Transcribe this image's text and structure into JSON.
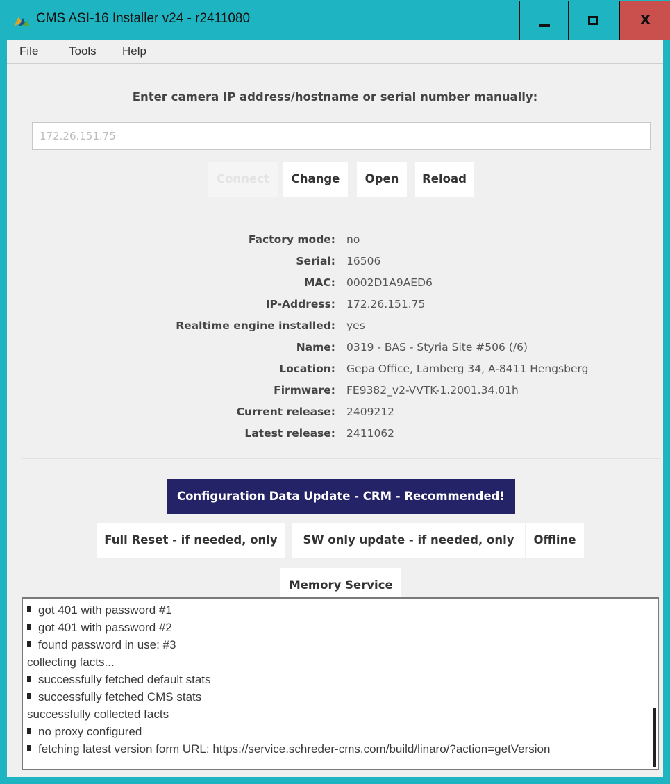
{
  "window": {
    "title": "CMS ASI-16 Installer v24 - r2411080",
    "close_glyph": "x",
    "colors": {
      "frame": "#1fb4c2",
      "close": "#c9504d",
      "primary_button": "#252367"
    }
  },
  "menubar": {
    "items": [
      "File",
      "Tools",
      "Help"
    ]
  },
  "connect": {
    "prompt": "Enter camera IP address/hostname or serial number manually:",
    "input_value": "172.26.151.75",
    "buttons": {
      "connect": "Connect",
      "change": "Change",
      "open": "Open",
      "reload": "Reload"
    }
  },
  "info": {
    "rows": [
      {
        "key": "Factory mode:",
        "value": "no"
      },
      {
        "key": "Serial:",
        "value": "16506"
      },
      {
        "key": "MAC:",
        "value": "0002D1A9AED6"
      },
      {
        "key": "IP-Address:",
        "value": "172.26.151.75"
      },
      {
        "key": "Realtime engine installed:",
        "value": "yes"
      },
      {
        "key": "Name:",
        "value": "0319 - BAS - Styria Site #506 (/6)"
      },
      {
        "key": "Location:",
        "value": "Gepa Office, Lamberg 34, A-8411 Hengsberg"
      },
      {
        "key": "Firmware:",
        "value": "FE9382_v2-VVTK-1.2001.34.01h"
      },
      {
        "key": "Current release:",
        "value": "2409212"
      },
      {
        "key": "Latest release:",
        "value": "2411062"
      }
    ]
  },
  "actions": {
    "config_update": "Configuration Data Update - CRM - Recommended!",
    "full_reset": "Full Reset - if needed, only",
    "sw_update": "SW only update - if needed, only",
    "offline": "Offline",
    "memory_service": "Memory Service"
  },
  "log": {
    "lines": [
      {
        "bullet": true,
        "text": "got 401 with password #1"
      },
      {
        "bullet": true,
        "text": "got 401 with password #2"
      },
      {
        "bullet": true,
        "text": "found password in use: #3"
      },
      {
        "bullet": false,
        "text": "collecting facts..."
      },
      {
        "bullet": true,
        "text": "successfully fetched default stats"
      },
      {
        "bullet": true,
        "text": "successfully fetched CMS stats"
      },
      {
        "bullet": false,
        "text": "successfully collected facts"
      },
      {
        "bullet": true,
        "text": "no proxy configured"
      },
      {
        "bullet": true,
        "text": "fetching latest version form URL: https://service.schreder-cms.com/build/linaro/?action=getVersion"
      }
    ]
  }
}
